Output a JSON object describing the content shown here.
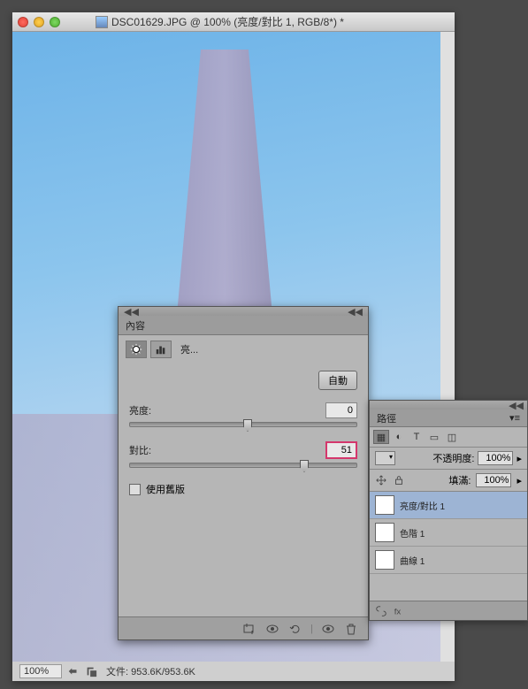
{
  "window": {
    "title": "DSC01629.JPG @ 100% (亮度/對比 1, RGB/8*) *"
  },
  "statusbar": {
    "zoom": "100%",
    "filesize": "文件: 953.6K/953.6K"
  },
  "adj_panel": {
    "tab": "內容",
    "mode": "亮...",
    "auto": "自動",
    "brightness_label": "亮度:",
    "brightness_value": "0",
    "contrast_label": "對比:",
    "contrast_value": "51",
    "legacy": "使用舊版"
  },
  "layers_panel": {
    "tab": "路徑",
    "opacity_label": "不透明度:",
    "opacity_value": "100%",
    "fill_label": "填滿:",
    "fill_value": "100%",
    "layers": [
      {
        "name": "亮度/對比 1"
      },
      {
        "name": "色階 1"
      },
      {
        "name": "曲線 1"
      }
    ]
  }
}
